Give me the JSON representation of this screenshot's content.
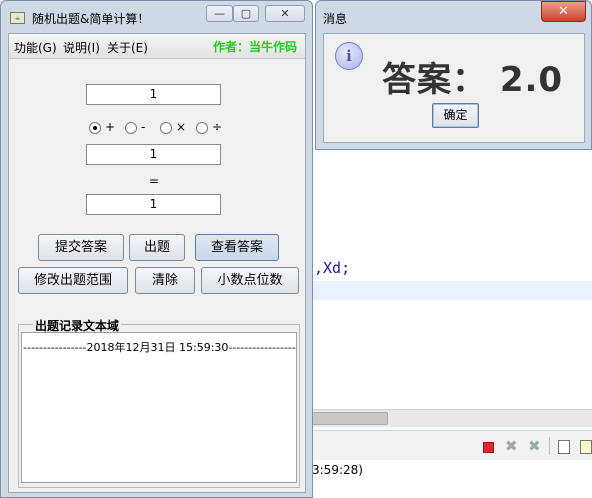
{
  "ide": {
    "code_visible": ",Xd;",
    "console_text": "3:59:28)"
  },
  "main_window": {
    "title": "随机出题&简单计算！",
    "menu": [
      {
        "label": "功能(G)"
      },
      {
        "label": "说明(I)"
      },
      {
        "label": "关于(E)"
      }
    ],
    "author": "作者：当牛作码",
    "operand1": "1",
    "operand2": "1",
    "result": "1",
    "equals": "=",
    "operators": [
      {
        "symbol": "+",
        "selected": true
      },
      {
        "symbol": "-",
        "selected": false
      },
      {
        "symbol": "×",
        "selected": false
      },
      {
        "symbol": "÷",
        "selected": false
      }
    ],
    "buttons": {
      "submit": "提交答案",
      "generate": "出题",
      "view_answer": "查看答案",
      "edit_range": "修改出题范围",
      "clear": "清除",
      "decimal": "小数点位数"
    },
    "record_group_title": "出题记录文本域",
    "record_line": "----------------2018年12月31日 15:59:30------------------"
  },
  "dialog": {
    "title": "消息",
    "message": "答案：  2.0",
    "ok_label": "确定"
  }
}
